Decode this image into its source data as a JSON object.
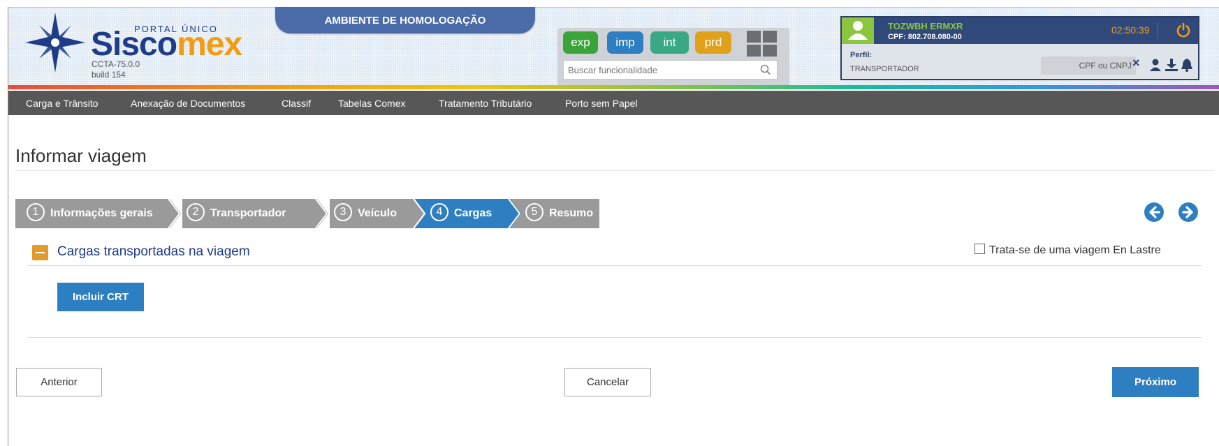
{
  "header": {
    "portal_label": "PORTAL ÚNICO",
    "brand_prefix": "Sisco",
    "brand_suffix": "mex",
    "version": "CCTA-75.0.0",
    "build": "build 154",
    "environment_banner": "AMBIENTE DE HOMOLOGAÇÃO",
    "env_buttons": [
      {
        "label": "exp",
        "color": "#3aa33a"
      },
      {
        "label": "imp",
        "color": "#2e7fc1"
      },
      {
        "label": "int",
        "color": "#3aa884"
      },
      {
        "label": "prd",
        "color": "#e0a21b"
      }
    ],
    "search": {
      "placeholder": "Buscar funcionalidade",
      "value": ""
    },
    "user": {
      "name": "TOZWBH ERMXR",
      "cpf": "CPF: 802.708.080-00",
      "session_timer": "02:50:39",
      "perfil_label": "Perfil:",
      "perfil_value": "TRANSPORTADOR",
      "cpf_cnpj_placeholder": "CPF ou CNPJ",
      "clear_symbol": "×"
    }
  },
  "nav": {
    "items": [
      {
        "label": "Carga e Trânsito"
      },
      {
        "label": "Anexação de Documentos"
      },
      {
        "label": "Classif"
      },
      {
        "label": "Tabelas Comex"
      },
      {
        "label": "Tratamento Tributário"
      },
      {
        "label": "Porto sem Papel"
      }
    ]
  },
  "page": {
    "title": "Informar viagem",
    "steps": [
      {
        "number": "1",
        "label": "Informações gerais",
        "active": false
      },
      {
        "number": "2",
        "label": "Transportador",
        "active": false
      },
      {
        "number": "3",
        "label": "Veículo",
        "active": false
      },
      {
        "number": "4",
        "label": "Cargas",
        "active": true
      },
      {
        "number": "5",
        "label": "Resumo",
        "active": false
      }
    ],
    "section_title": "Cargas transportadas na viagem",
    "en_lastre_label": "Trata-se de uma viagem En Lastre",
    "en_lastre_checked": false,
    "include_button": "Incluir CRT",
    "back_button": "Anterior",
    "cancel_button": "Cancelar",
    "next_button": "Próximo"
  },
  "colors": {
    "primary": "#2e7fc1",
    "nav_bg": "#575757",
    "brand_blue": "#1f3c88",
    "brand_orange": "#f39c12",
    "step_inactive": "#9a9a9a"
  }
}
